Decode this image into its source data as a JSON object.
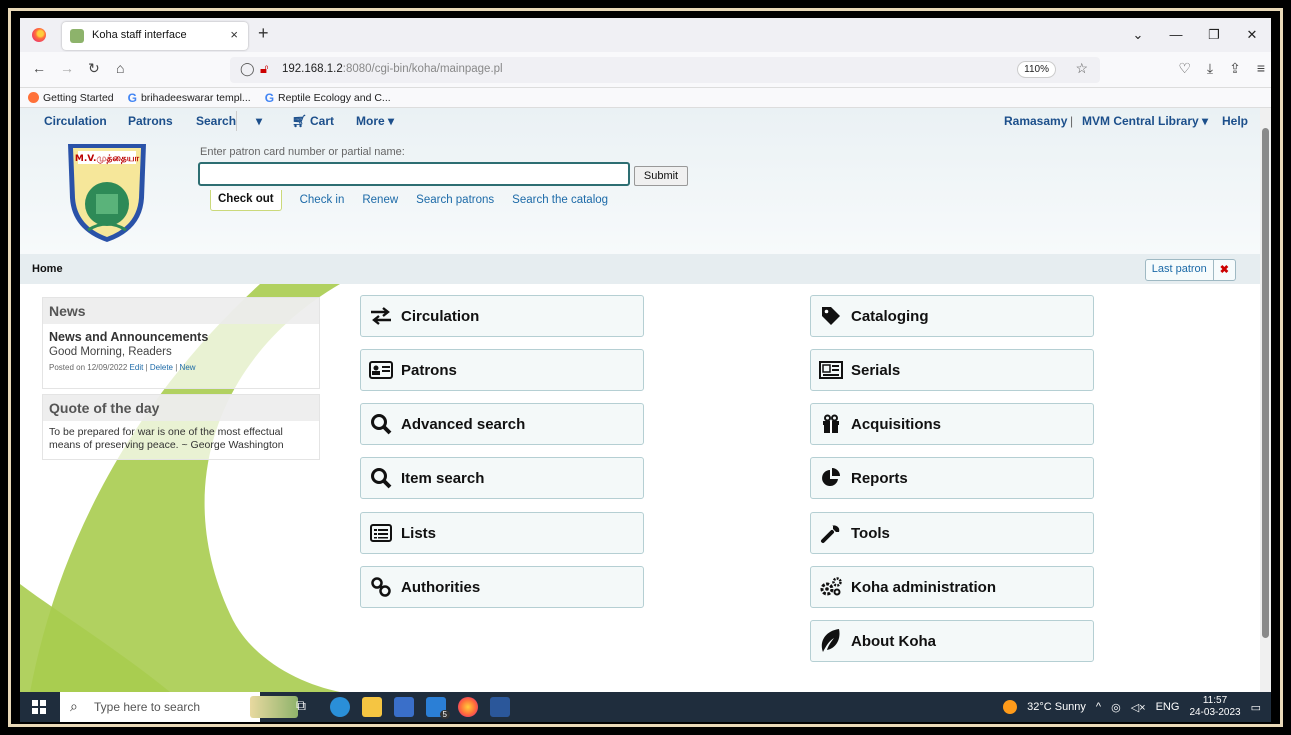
{
  "browser": {
    "tab_title": "Koha staff interface",
    "tab_close": "×",
    "new_tab": "+",
    "url_host": "192.168.1.2",
    "url_rest": ":8080/cgi-bin/koha/mainpage.pl",
    "zoom": "110%",
    "bookmarks": [
      "Getting Started",
      "brihadeeswarar templ...",
      "Reptile Ecology and C..."
    ]
  },
  "koha_menu": {
    "circulation": "Circulation",
    "patrons": "Patrons",
    "search": "Search",
    "cart": "Cart",
    "more": "More",
    "user": "Ramasamy",
    "separator": "|",
    "library": "MVM Central Library",
    "help": "Help"
  },
  "logo_text": "M.V.முத்தையா",
  "patron_search": {
    "label": "Enter patron card number or partial name:",
    "value": "",
    "submit": "Submit",
    "tabs": [
      "Check out",
      "Check in",
      "Renew",
      "Search patrons",
      "Search the catalog"
    ]
  },
  "breadcrumb": {
    "home": "Home",
    "last_patron": "Last patron",
    "last_patron_clear": "✖"
  },
  "news": {
    "heading": "News",
    "title": "News and Announcements",
    "body": "Good Morning, Readers",
    "posted": "Posted on 12/09/2022",
    "edit": "Edit",
    "delete": "Delete",
    "new": "New",
    "sep": "|"
  },
  "quote": {
    "heading": "Quote of the day",
    "text": "To be prepared for war is one of the most effectual means of preserving peace. ~ George Washington"
  },
  "modules_left": [
    {
      "label": "Circulation",
      "icon": "exchange-icon"
    },
    {
      "label": "Patrons",
      "icon": "id-card-icon"
    },
    {
      "label": "Advanced search",
      "icon": "search-icon"
    },
    {
      "label": "Item search",
      "icon": "search-icon"
    },
    {
      "label": "Lists",
      "icon": "list-icon"
    },
    {
      "label": "Authorities",
      "icon": "link-icon"
    }
  ],
  "modules_right": [
    {
      "label": "Cataloging",
      "icon": "tag-icon"
    },
    {
      "label": "Serials",
      "icon": "newspaper-icon"
    },
    {
      "label": "Acquisitions",
      "icon": "gift-icon"
    },
    {
      "label": "Reports",
      "icon": "pie-chart-icon"
    },
    {
      "label": "Tools",
      "icon": "wrench-icon"
    },
    {
      "label": "Koha administration",
      "icon": "cogs-icon"
    },
    {
      "label": "About Koha",
      "icon": "koha-leaf-icon"
    }
  ],
  "taskbar": {
    "search_placeholder": "Type here to search",
    "weather": "32°C Sunny",
    "lang": "ENG",
    "time": "11:57",
    "date": "24-03-2023",
    "badge": "5"
  }
}
